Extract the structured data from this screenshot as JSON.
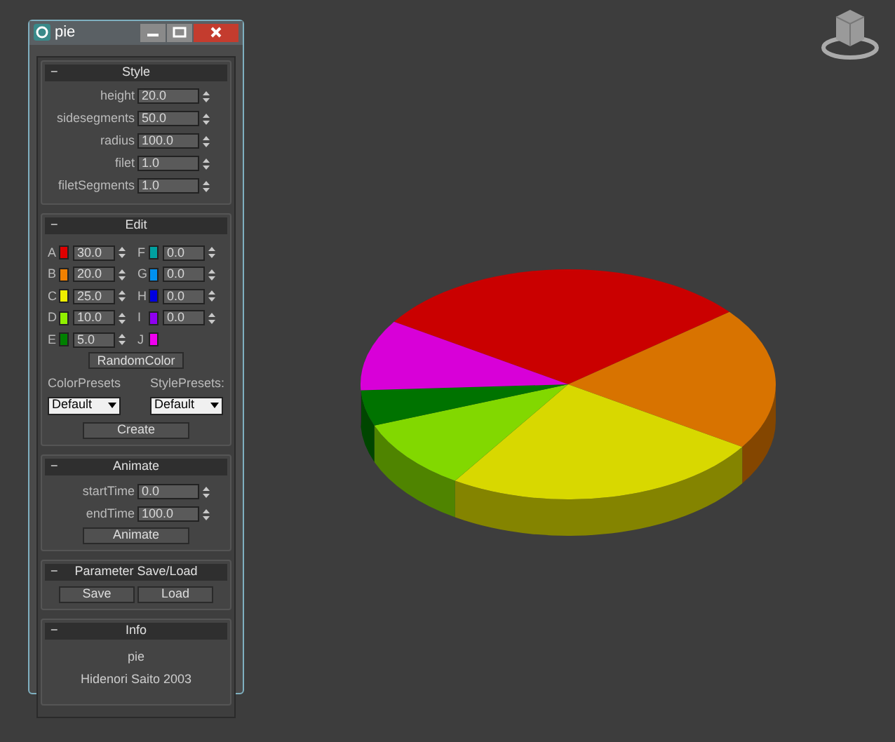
{
  "window": {
    "title": "pie",
    "buttons": [
      {
        "kind": "minimize"
      },
      {
        "kind": "maximize"
      },
      {
        "kind": "close"
      }
    ]
  },
  "style": {
    "toggle": "−",
    "title": "Style",
    "params": [
      {
        "label": "height",
        "value": "20.0"
      },
      {
        "label": "sidesegments",
        "value": "50.0"
      },
      {
        "label": "radius",
        "value": "100.0"
      },
      {
        "label": "filet",
        "value": "1.0"
      },
      {
        "label": "filetSegments",
        "value": "1.0"
      }
    ]
  },
  "edit": {
    "toggle": "−",
    "title": "Edit",
    "slices": [
      {
        "letter": "A",
        "color": "#e00000",
        "value": "30.0"
      },
      {
        "letter": "B",
        "color": "#f08000",
        "value": "20.0"
      },
      {
        "letter": "C",
        "color": "#f0f000",
        "value": "25.0"
      },
      {
        "letter": "D",
        "color": "#90f000",
        "value": "10.0"
      },
      {
        "letter": "E",
        "color": "#008000",
        "value": "5.0"
      },
      {
        "letter": "F",
        "color": "#00a0a0",
        "value": "0.0"
      },
      {
        "letter": "G",
        "color": "#0090f0",
        "value": "0.0"
      },
      {
        "letter": "H",
        "color": "#0000e0",
        "value": "0.0"
      },
      {
        "letter": "I",
        "color": "#9000f0",
        "value": "0.0"
      },
      {
        "letter": "J",
        "color": "#f000f0"
      }
    ],
    "random_button": "RandomColor",
    "color_presets": {
      "label": "ColorPresets",
      "value": "Default"
    },
    "style_presets": {
      "label": "StylePresets:",
      "value": "Default"
    },
    "create_button": "Create"
  },
  "animate": {
    "toggle": "−",
    "title": "Animate",
    "params": [
      {
        "label": "startTime",
        "value": "0.0"
      },
      {
        "label": "endTime",
        "value": "100.0"
      }
    ],
    "button": "Animate"
  },
  "save_load": {
    "toggle": "−",
    "title": "Parameter Save/Load",
    "buttons": [
      "Save",
      "Load"
    ]
  },
  "info": {
    "toggle": "−",
    "title": "Info",
    "lines": [
      "pie",
      "Hidenori Saito 2003"
    ]
  }
}
